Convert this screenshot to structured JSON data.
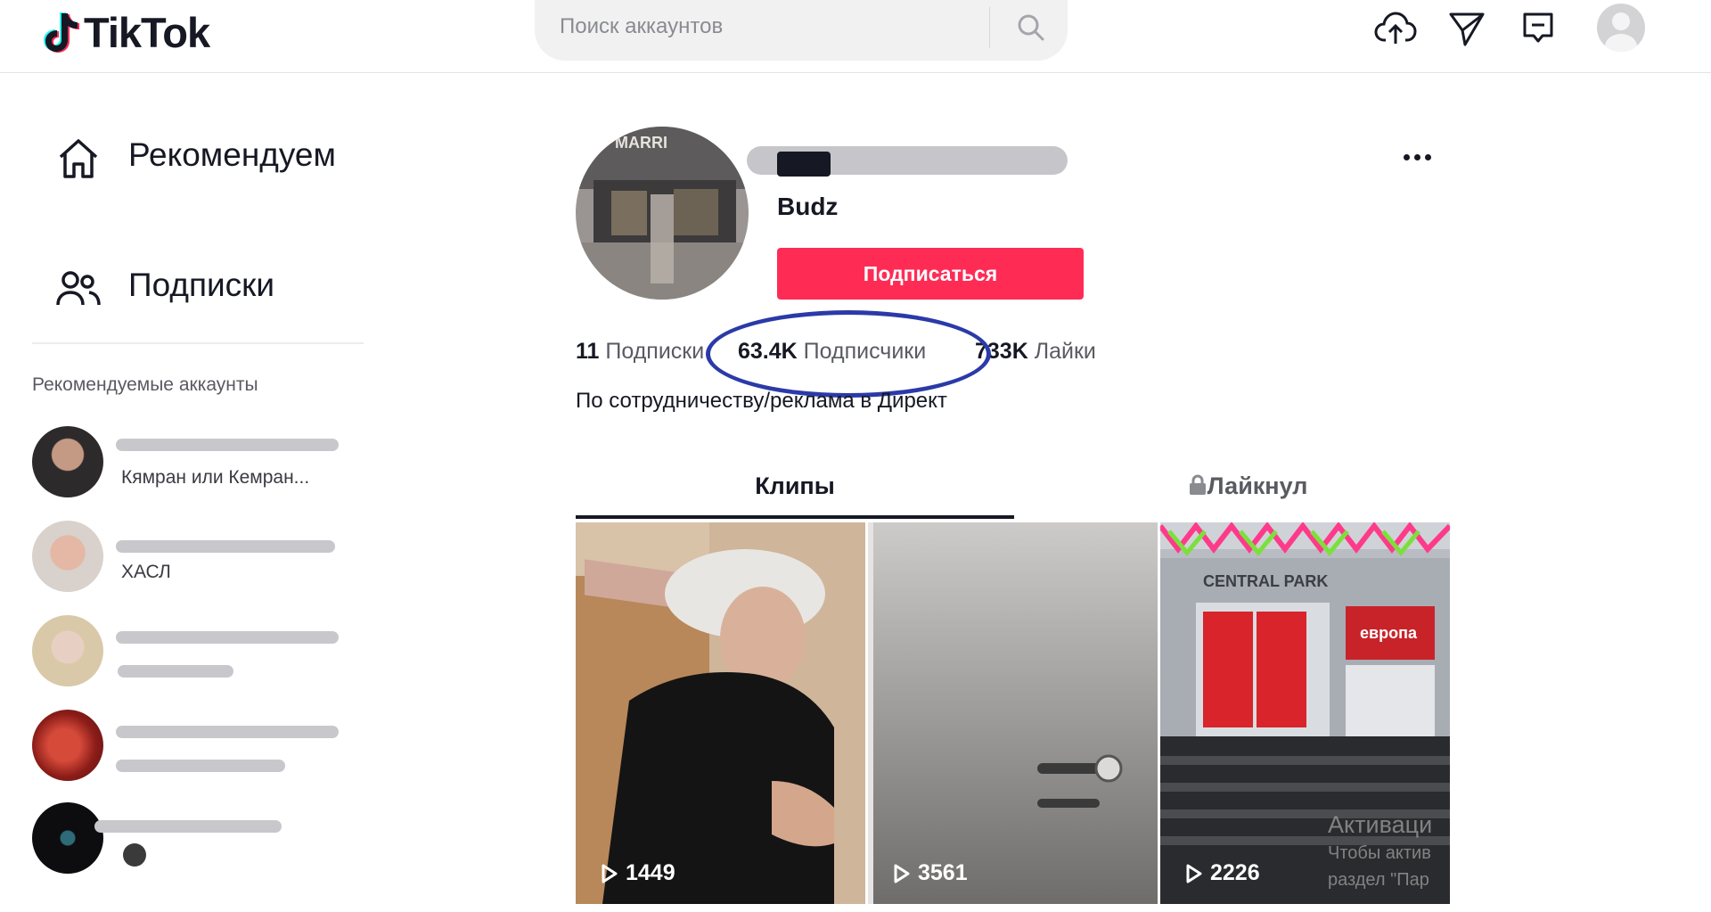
{
  "header": {
    "logo_text": "TikTok",
    "search_placeholder": "Поиск аккаунтов",
    "icons": [
      "upload-icon",
      "send-icon",
      "inbox-icon"
    ]
  },
  "sidebar": {
    "nav": [
      {
        "label": "Рекомендуем",
        "icon": "home-icon"
      },
      {
        "label": "Подписки",
        "icon": "following-icon"
      }
    ],
    "recommended_title": "Рекомендуемые аккаунты",
    "accounts": [
      {
        "subtitle": "Кямран или Кемран..."
      },
      {
        "subtitle": "ХАСЛ"
      },
      {
        "subtitle": ""
      },
      {
        "subtitle": ""
      },
      {
        "subtitle": ""
      }
    ]
  },
  "profile": {
    "avatar_text": "MARRI",
    "nickname": "Budz",
    "follow_label": "Подписаться",
    "following_count": "11",
    "following_label": "Подписки",
    "followers_count": "63.4K",
    "followers_label": "Подписчики",
    "likes_count": "733K",
    "likes_label": "Лайки",
    "bio": "По сотрудничеству/реклама в Директ"
  },
  "tabs": {
    "clips": "Клипы",
    "liked": "Лайкнул"
  },
  "videos": [
    {
      "views": "1449",
      "theme": "person"
    },
    {
      "views": "3561",
      "theme": "door"
    },
    {
      "views": "2226",
      "theme": "mall",
      "sign": "CENTRAL PARK",
      "store_sign": "европа"
    }
  ],
  "watermark": {
    "line1": "Активаци",
    "line2": "Чтобы актив",
    "line3": "раздел \"Пар"
  }
}
